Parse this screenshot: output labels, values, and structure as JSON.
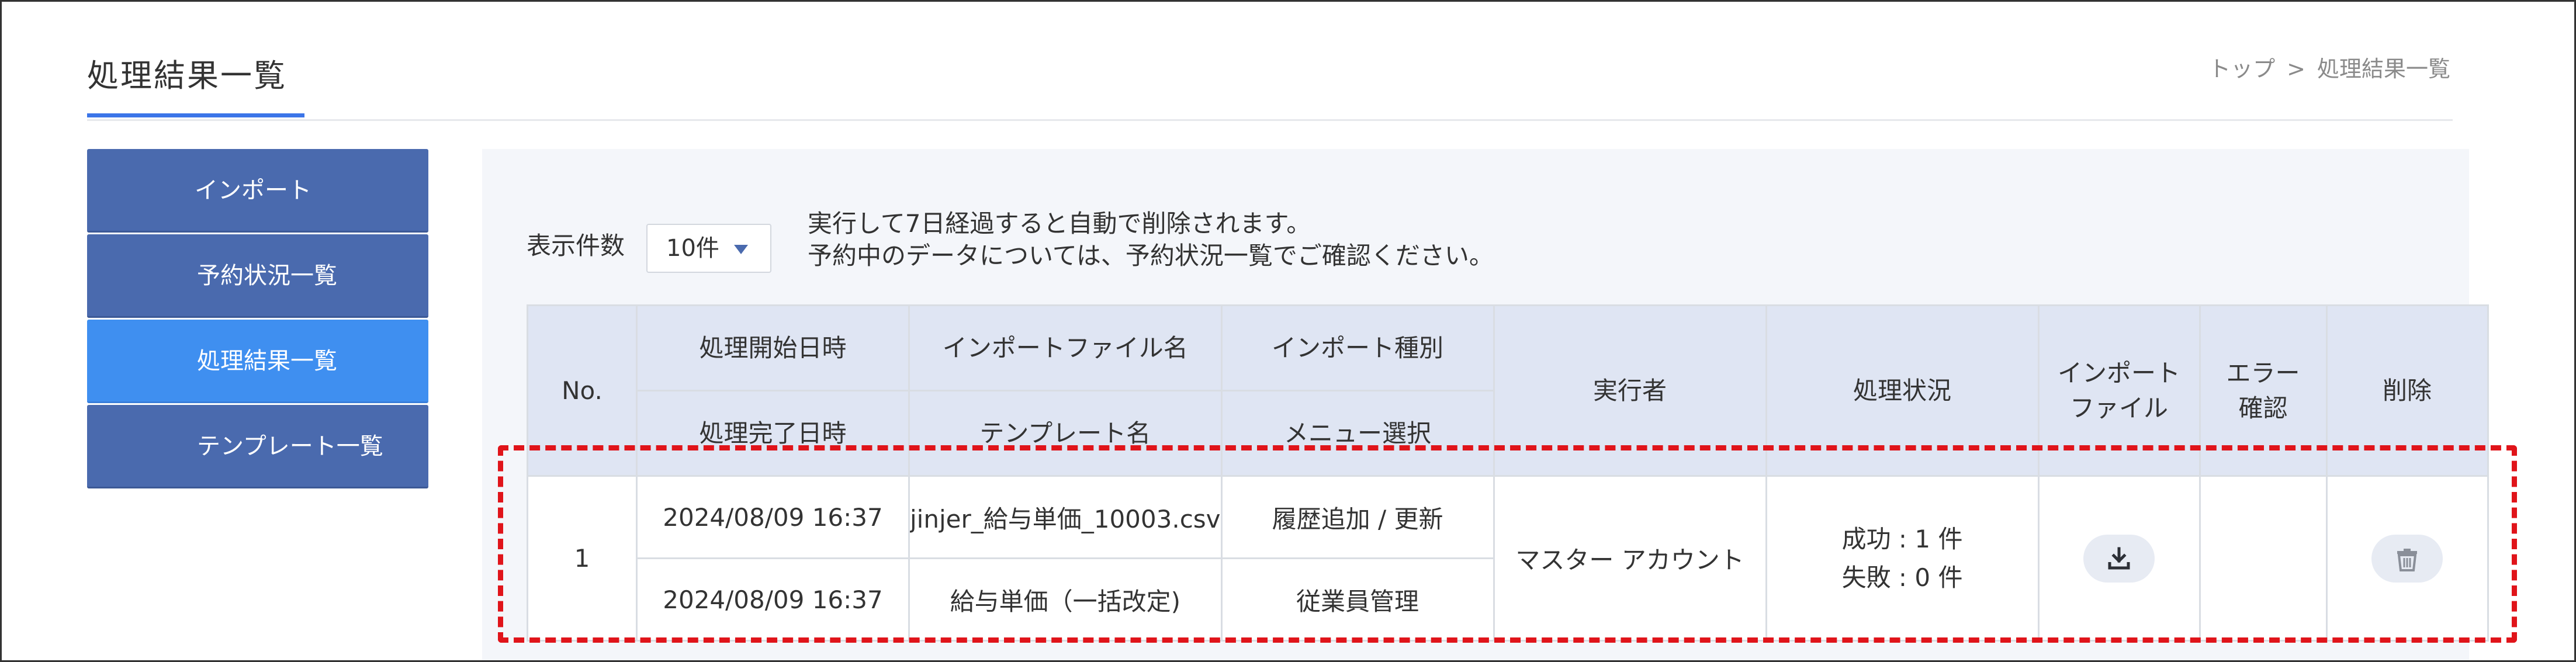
{
  "page": {
    "title": "処理結果一覧",
    "breadcrumb": {
      "top": "トップ",
      "separator": ">",
      "current": "処理結果一覧"
    }
  },
  "sidebar": {
    "items": [
      {
        "label": "インポート",
        "active": false
      },
      {
        "label": "予約状況一覧",
        "active": false
      },
      {
        "label": "処理結果一覧",
        "active": true
      },
      {
        "label": "テンプレート一覧",
        "active": false
      }
    ]
  },
  "controls": {
    "display_count_label": "表示件数",
    "display_count_value": "10件",
    "notice_line1": "実行して7日経過すると自動で削除されます。",
    "notice_line2": "予約中のデータについては、予約状況一覧でご確認ください。"
  },
  "table": {
    "headers": {
      "no": "No.",
      "start_datetime": "処理開始日時",
      "end_datetime": "処理完了日時",
      "import_file_name": "インポートファイル名",
      "template_name": "テンプレート名",
      "import_type": "インポート種別",
      "menu_select": "メニュー選択",
      "executor": "実行者",
      "status": "処理状況",
      "import_file_line1": "インポート",
      "import_file_line2": "ファイル",
      "error_check_line1": "エラー",
      "error_check_line2": "確認",
      "delete": "削除"
    },
    "rows": [
      {
        "no": "1",
        "start_datetime": "2024/08/09 16:37",
        "end_datetime": "2024/08/09 16:37",
        "import_file_name": "jinjer_給与単価_10003.csv",
        "template_name": "給与単価（一括改定)",
        "import_type": "履歴追加 / 更新",
        "menu_select": "従業員管理",
        "executor": "マスター アカウント",
        "status_success": "成功 : 1 件",
        "status_failure": "失敗 : 0 件"
      }
    ]
  },
  "icons": {
    "download": "download-icon",
    "delete": "trash-icon",
    "dropdown": "caret-down-icon"
  },
  "colors": {
    "sidebar_bg": "#4a6aae",
    "sidebar_active_bg": "#3f8ff0",
    "table_header_bg": "#dfe5f3",
    "accent_underline": "#3b75e8",
    "highlight_border": "#e0141a"
  }
}
